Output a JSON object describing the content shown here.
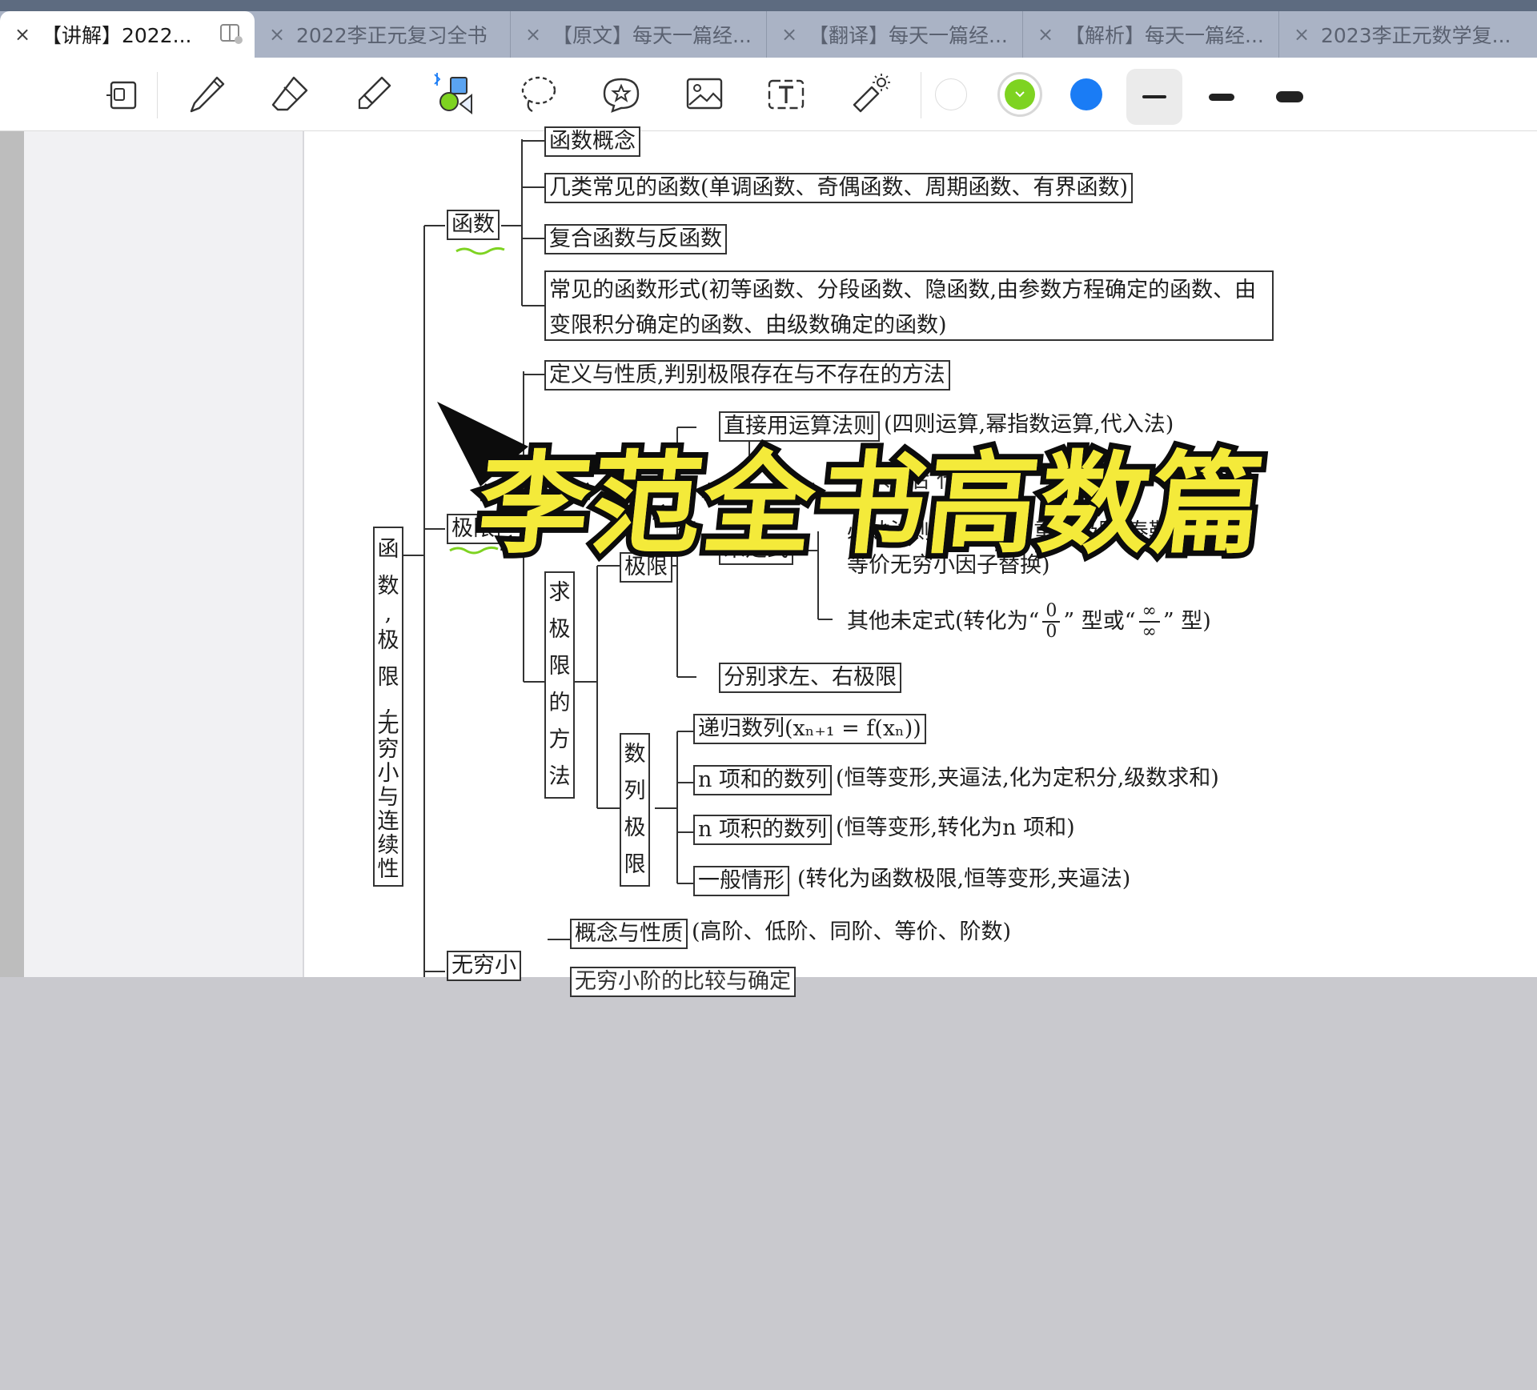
{
  "tabs": [
    {
      "label": "【讲解】2022...",
      "active": true
    },
    {
      "label": "2022李正元复习全书",
      "active": false
    },
    {
      "label": "【原文】每天一篇经...",
      "active": false
    },
    {
      "label": "【翻译】每天一篇经...",
      "active": false
    },
    {
      "label": "【解析】每天一篇经...",
      "active": false
    },
    {
      "label": "2023李正元数学复...",
      "active": false
    }
  ],
  "close_glyph": "×",
  "toolbar": {
    "tools": [
      "page-view-icon",
      "pen-icon",
      "eraser-icon",
      "highlighter-icon",
      "shapes-icon",
      "lasso-icon",
      "sticker-icon",
      "image-icon",
      "text-icon",
      "laser-pointer-icon"
    ],
    "colors": [
      "#ffffff",
      "#7ed321",
      "#1a7cf5"
    ],
    "selected_color": "#7ed321",
    "thicknesses": [
      "thin",
      "medium",
      "thick"
    ],
    "selected_thickness": "thin"
  },
  "diagram": {
    "root": [
      "函",
      "数",
      ",",
      "极",
      "限",
      ",",
      "无",
      "穷",
      "小",
      "与",
      "连",
      "续",
      "性"
    ],
    "functions": {
      "label": "函数",
      "items": [
        "函数概念",
        "几类常见的函数(单调函数、奇偶函数、周期函数、有界函数)",
        "复合函数与反函数",
        "常见的函数形式(初等函数、分段函数、隐函数,由参数方程确定的函数、由",
        "变限积分确定的函数、由级数确定的函数)"
      ]
    },
    "limits": {
      "label": "极限",
      "definition": "定义与性质,判别极限存在与不存在的方法",
      "method": [
        "求",
        "极",
        "限",
        "的",
        "方",
        "法"
      ],
      "func_limit": "极限",
      "direct": "直接用运算法则",
      "direct_note": "(四则运算,幂指数运算,代入法)",
      "frag_mid": "“  ”  等  后 代",
      "undetermined": "未定式",
      "undetermined_line1": "必达法则,变量替换,重要极限,泰勒公式",
      "undetermined_line2": "等价无穷小因子替换)",
      "other_prefix": "其他未定式(转化为“",
      "frac1_num": "0",
      "frac1_den": "0",
      "other_mid": "” 型或“",
      "frac2_num": "∞",
      "frac2_den": "∞",
      "other_suffix": "” 型)",
      "left_right": "分别求左、右极限",
      "seq_label": [
        "数",
        "列",
        "极",
        "限"
      ],
      "recursive": "递归数列(xₙ₊₁ = f(xₙ))",
      "nsum": "n 项和的数列",
      "nsum_note": "(恒等变形,夹逼法,化为定积分,级数求和)",
      "nprod": "n 项积的数列",
      "nprod_note": "(恒等变形,转化为n 项和)",
      "general": "一般情形",
      "general_note": "(转化为函数极限,恒等变形,夹逼法)"
    },
    "infinitesimal": {
      "label": "无穷小",
      "concept": "概念与性质",
      "concept_note": "(高阶、低阶、同阶、等价、阶数)",
      "compare": "无穷小阶的比较与确定"
    }
  },
  "overlay_title": "李范全书高数篇"
}
